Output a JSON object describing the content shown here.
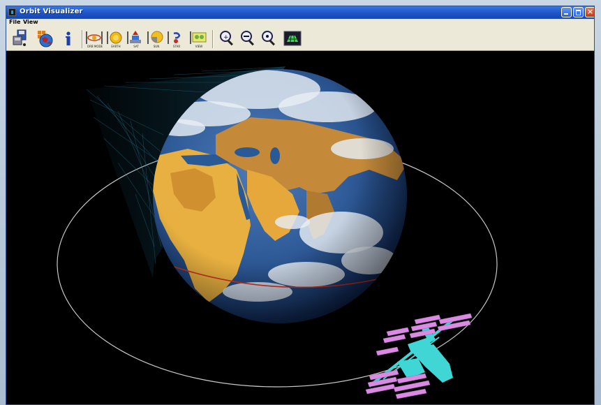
{
  "window": {
    "title": "Orbit Visualizer",
    "close_glyph": "×"
  },
  "menu": {
    "items": [
      "File",
      "View"
    ]
  },
  "toolbar": {
    "captions": [
      "ORB MODE",
      "EARTH",
      "SAT",
      "SUN",
      "STAR",
      "VIEW"
    ]
  },
  "icons": {
    "save": "save-disk-icon",
    "globe": "globe-icon",
    "info": "info-icon",
    "zoom_in": "zoom-in-icon",
    "zoom_out": "zoom-out-icon",
    "zoom_reset": "zoom-reset-icon",
    "grid": "grid-view-icon"
  },
  "colors": {
    "titlebar": "#1c54c8",
    "orbit_ring": "#c8c8c8",
    "equator": "#d0321e",
    "solar_panel": "#d88be0",
    "station_body": "#40d6d6"
  }
}
